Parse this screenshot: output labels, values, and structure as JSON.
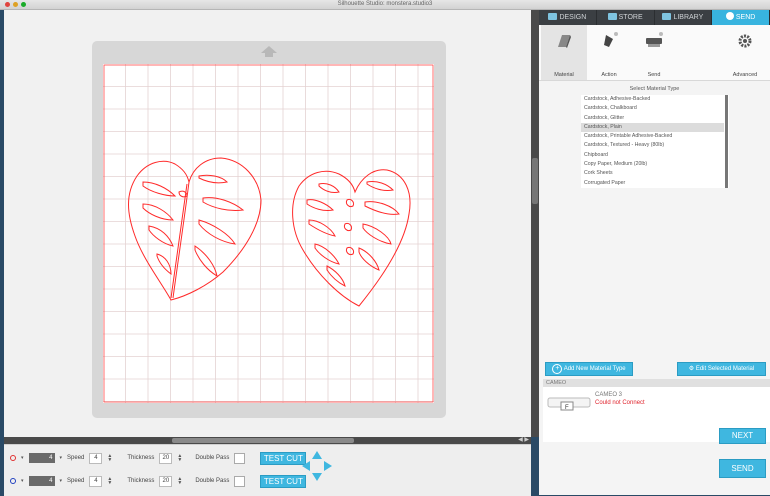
{
  "window": {
    "title": "Silhouette Studio: monstera.studio3"
  },
  "nav_tabs": [
    {
      "label": "DESIGN",
      "icon": "grid-icon",
      "active": false
    },
    {
      "label": "STORE",
      "icon": "store-icon",
      "active": false
    },
    {
      "label": "LIBRARY",
      "icon": "cloud-icon",
      "active": false
    },
    {
      "label": "SEND",
      "icon": "send-icon",
      "active": true
    }
  ],
  "send_tabs": [
    {
      "label": "Material",
      "icon": "material-icon",
      "active": true
    },
    {
      "label": "Action",
      "icon": "blade-icon",
      "active": false
    },
    {
      "label": "Send",
      "icon": "machine-icon",
      "active": false
    },
    {
      "label": "Advanced",
      "icon": "gear-icon",
      "active": false
    }
  ],
  "material": {
    "heading": "Select Material Type",
    "items": [
      "Cardstock, Adhesive-Backed",
      "Cardstock, Chalkboard",
      "Cardstock, Glitter",
      "Cardstock, Plain",
      "Cardstock, Printable Adhesive-Backed",
      "Cardstock, Textured - Heavy (80lb)",
      "Chipboard",
      "Copy Paper, Medium (20lb)",
      "Cork Sheets",
      "Corrugated Paper"
    ],
    "selected_index": 3,
    "add_button": "Add New Material Type",
    "edit_button": "Edit Selected Material"
  },
  "device": {
    "section_label": "CAMEO",
    "name": "CAMEO 3",
    "status": "Could not Connect",
    "next_button": "NEXT",
    "send_button": "SEND"
  },
  "toolbar": {
    "rows": [
      {
        "tool_color": "#e03030",
        "blade": "4",
        "speed_label": "Speed",
        "speed": "4",
        "thickness_label": "Thickness",
        "thickness": "20",
        "double_pass_label": "Double Pass",
        "test_cut": "TEST CUT"
      },
      {
        "tool_color": "#2040c0",
        "blade": "4",
        "speed_label": "Speed",
        "speed": "4",
        "thickness_label": "Thickness",
        "thickness": "20",
        "double_pass_label": "Double Pass",
        "test_cut": "TEST CUT"
      }
    ]
  },
  "colors": {
    "accent": "#3fb7e0",
    "cut_line": "#ff2a2a",
    "grid": "#e6c9c9",
    "error": "#e0252e"
  }
}
